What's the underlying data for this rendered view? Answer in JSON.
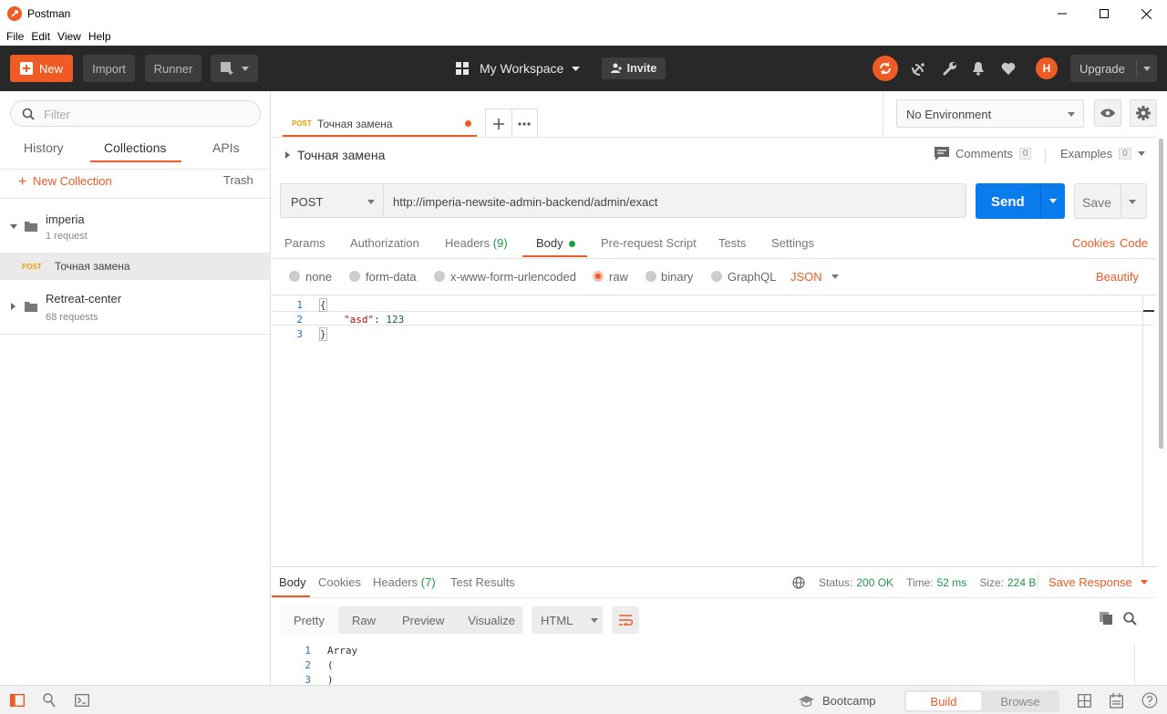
{
  "window": {
    "title": "Postman"
  },
  "menu": [
    "File",
    "Edit",
    "View",
    "Help"
  ],
  "header": {
    "new_label": "New",
    "import_label": "Import",
    "runner_label": "Runner",
    "workspace_label": "My Workspace",
    "invite_label": "Invite",
    "avatar_initial": "H",
    "upgrade_label": "Upgrade"
  },
  "sidebar": {
    "filter_placeholder": "Filter",
    "tabs": [
      "History",
      "Collections",
      "APIs"
    ],
    "active_tab": "Collections",
    "new_collection_label": "New Collection",
    "trash_label": "Trash",
    "collections": [
      {
        "name": "imperia",
        "count": "1 request",
        "expanded": true,
        "requests": [
          {
            "method": "POST",
            "name": "Точная замена"
          }
        ]
      },
      {
        "name": "Retreat-center",
        "count": "68 requests",
        "expanded": false
      }
    ]
  },
  "tabs": [
    {
      "method": "POST",
      "name": "Точная замена",
      "unsaved": true
    }
  ],
  "environment": {
    "selected": "No Environment"
  },
  "request": {
    "title": "Точная замена",
    "comments_label": "Comments",
    "comments_count": "0",
    "examples_label": "Examples",
    "examples_count": "0",
    "method": "POST",
    "url": "http://imperia-newsite-admin-backend/admin/exact",
    "send_label": "Send",
    "save_label": "Save",
    "subtabs": {
      "params": "Params",
      "authorization": "Authorization",
      "headers": "Headers",
      "headers_count": "(9)",
      "body": "Body",
      "prerequest": "Pre-request Script",
      "tests": "Tests",
      "settings": "Settings",
      "cookies": "Cookies",
      "code": "Code"
    },
    "body_modes": [
      "none",
      "form-data",
      "x-www-form-urlencoded",
      "raw",
      "binary",
      "GraphQL"
    ],
    "selected_mode": "raw",
    "content_type": "JSON",
    "beautify_label": "Beautify",
    "body_lines": [
      {
        "n": "1",
        "text": "{"
      },
      {
        "n": "2",
        "key": "\"asd\"",
        "sep": ": ",
        "val": "123"
      },
      {
        "n": "3",
        "text": "}"
      }
    ]
  },
  "response": {
    "tabs": {
      "body": "Body",
      "cookies": "Cookies",
      "headers": "Headers",
      "headers_count": "(7)",
      "tests": "Test Results"
    },
    "status_label": "Status:",
    "status_value": "200 OK",
    "time_label": "Time:",
    "time_value": "52 ms",
    "size_label": "Size:",
    "size_value": "224 B",
    "save_response_label": "Save Response",
    "formats": [
      "Pretty",
      "Raw",
      "Preview",
      "Visualize"
    ],
    "format_type": "HTML",
    "lines": [
      {
        "n": "1",
        "text": "Array"
      },
      {
        "n": "2",
        "text": "("
      },
      {
        "n": "3",
        "text": ")"
      }
    ]
  },
  "statusbar": {
    "bootcamp_label": "Bootcamp",
    "build_label": "Build",
    "browse_label": "Browse"
  },
  "colors": {
    "accent": "#ef5b25",
    "send_blue": "#097bed",
    "header_bg": "#282828",
    "ok_green": "#1c9b43"
  }
}
